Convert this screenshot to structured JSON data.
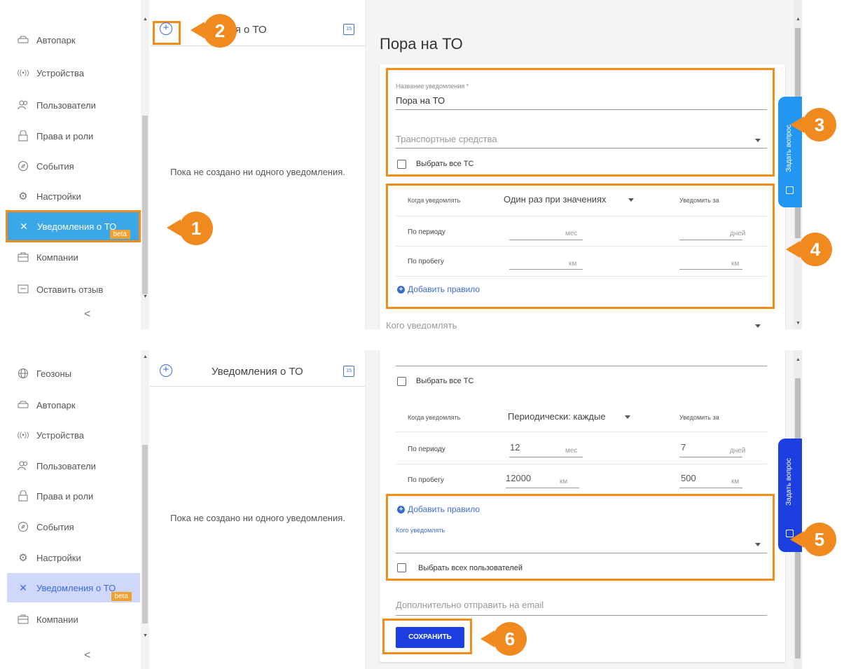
{
  "top": {
    "sidebar": {
      "items": [
        {
          "label": "Автопарк",
          "icon": "car-icon"
        },
        {
          "label": "Устройства",
          "icon": "antenna-icon"
        },
        {
          "label": "Пользователи",
          "icon": "users-icon"
        },
        {
          "label": "Права и роли",
          "icon": "lock-icon"
        },
        {
          "label": "События",
          "icon": "compass-icon"
        },
        {
          "label": "Настройки",
          "icon": "gear-icon"
        },
        {
          "label": "Уведомления о ТО",
          "icon": "wrench-icon",
          "badge": "beta",
          "active": true
        },
        {
          "label": "Компании",
          "icon": "briefcase-icon"
        },
        {
          "label": "Оставить отзыв",
          "icon": "feedback-icon"
        }
      ],
      "collapse": "<"
    },
    "list": {
      "title": "ления о ТО",
      "calendar": "15",
      "empty": "Пока не создано ни одного уведомления."
    },
    "form": {
      "title": "Пора на ТО",
      "name_label": "Название уведомления *",
      "name_value": "Пора на ТО",
      "vehicles_placeholder": "Транспортные средства",
      "select_all_vehicles": "Выбрать все ТС",
      "when_label": "Когда уведомлять",
      "mode": "Один раз при значениях",
      "notify_before": "Уведомить за",
      "period_label": "По периоду",
      "period_unit": "мес",
      "period_before_unit": "дней",
      "mileage_label": "По пробегу",
      "mileage_unit": "км",
      "mileage_before_unit": "км",
      "add_rule": "Добавить правило",
      "whom": "Кого уведомлять"
    },
    "ask_tab": "Задать вопрос",
    "callouts": [
      "1",
      "2",
      "3",
      "4"
    ]
  },
  "bottom": {
    "sidebar": {
      "items": [
        {
          "label": "Геозоны",
          "icon": "globe-icon"
        },
        {
          "label": "Автопарк",
          "icon": "car-icon"
        },
        {
          "label": "Устройства",
          "icon": "antenna-icon"
        },
        {
          "label": "Пользователи",
          "icon": "users-icon"
        },
        {
          "label": "Права и роли",
          "icon": "lock-icon"
        },
        {
          "label": "События",
          "icon": "compass-icon"
        },
        {
          "label": "Настройки",
          "icon": "gear-icon"
        },
        {
          "label": "Уведомления о ТО",
          "icon": "wrench-icon",
          "badge": "beta",
          "active": true
        },
        {
          "label": "Компании",
          "icon": "briefcase-icon"
        }
      ],
      "collapse": "<"
    },
    "list": {
      "title": "Уведомления о ТО",
      "calendar": "15",
      "empty": "Пока не создано ни одного уведомления."
    },
    "form": {
      "select_all_vehicles": "Выбрать все ТС",
      "when_label": "Когда уведомлять",
      "mode": "Периодически: каждые",
      "notify_before": "Уведомить за",
      "period_label": "По периоду",
      "period_value": "12",
      "period_unit": "мес",
      "period_before_value": "7",
      "period_before_unit": "дней",
      "mileage_label": "По пробегу",
      "mileage_value": "12000",
      "mileage_unit": "км",
      "mileage_before_value": "500",
      "mileage_before_unit": "км",
      "add_rule": "Добавить правило",
      "whom_label": "Кого уведомлять",
      "select_all_users": "Выбрать всех пользователей",
      "email_placeholder": "Дополнительно отправить на email",
      "save": "СОХРАНИТЬ"
    },
    "ask_tab": "Задать вопрос",
    "callouts": [
      "5",
      "6"
    ]
  },
  "colors": {
    "accent": "#3a6ad8",
    "highlight": "#f28c1a",
    "callout": "#f08a1f",
    "save": "#1e3fe0",
    "active_item": "#3aa7e8"
  }
}
